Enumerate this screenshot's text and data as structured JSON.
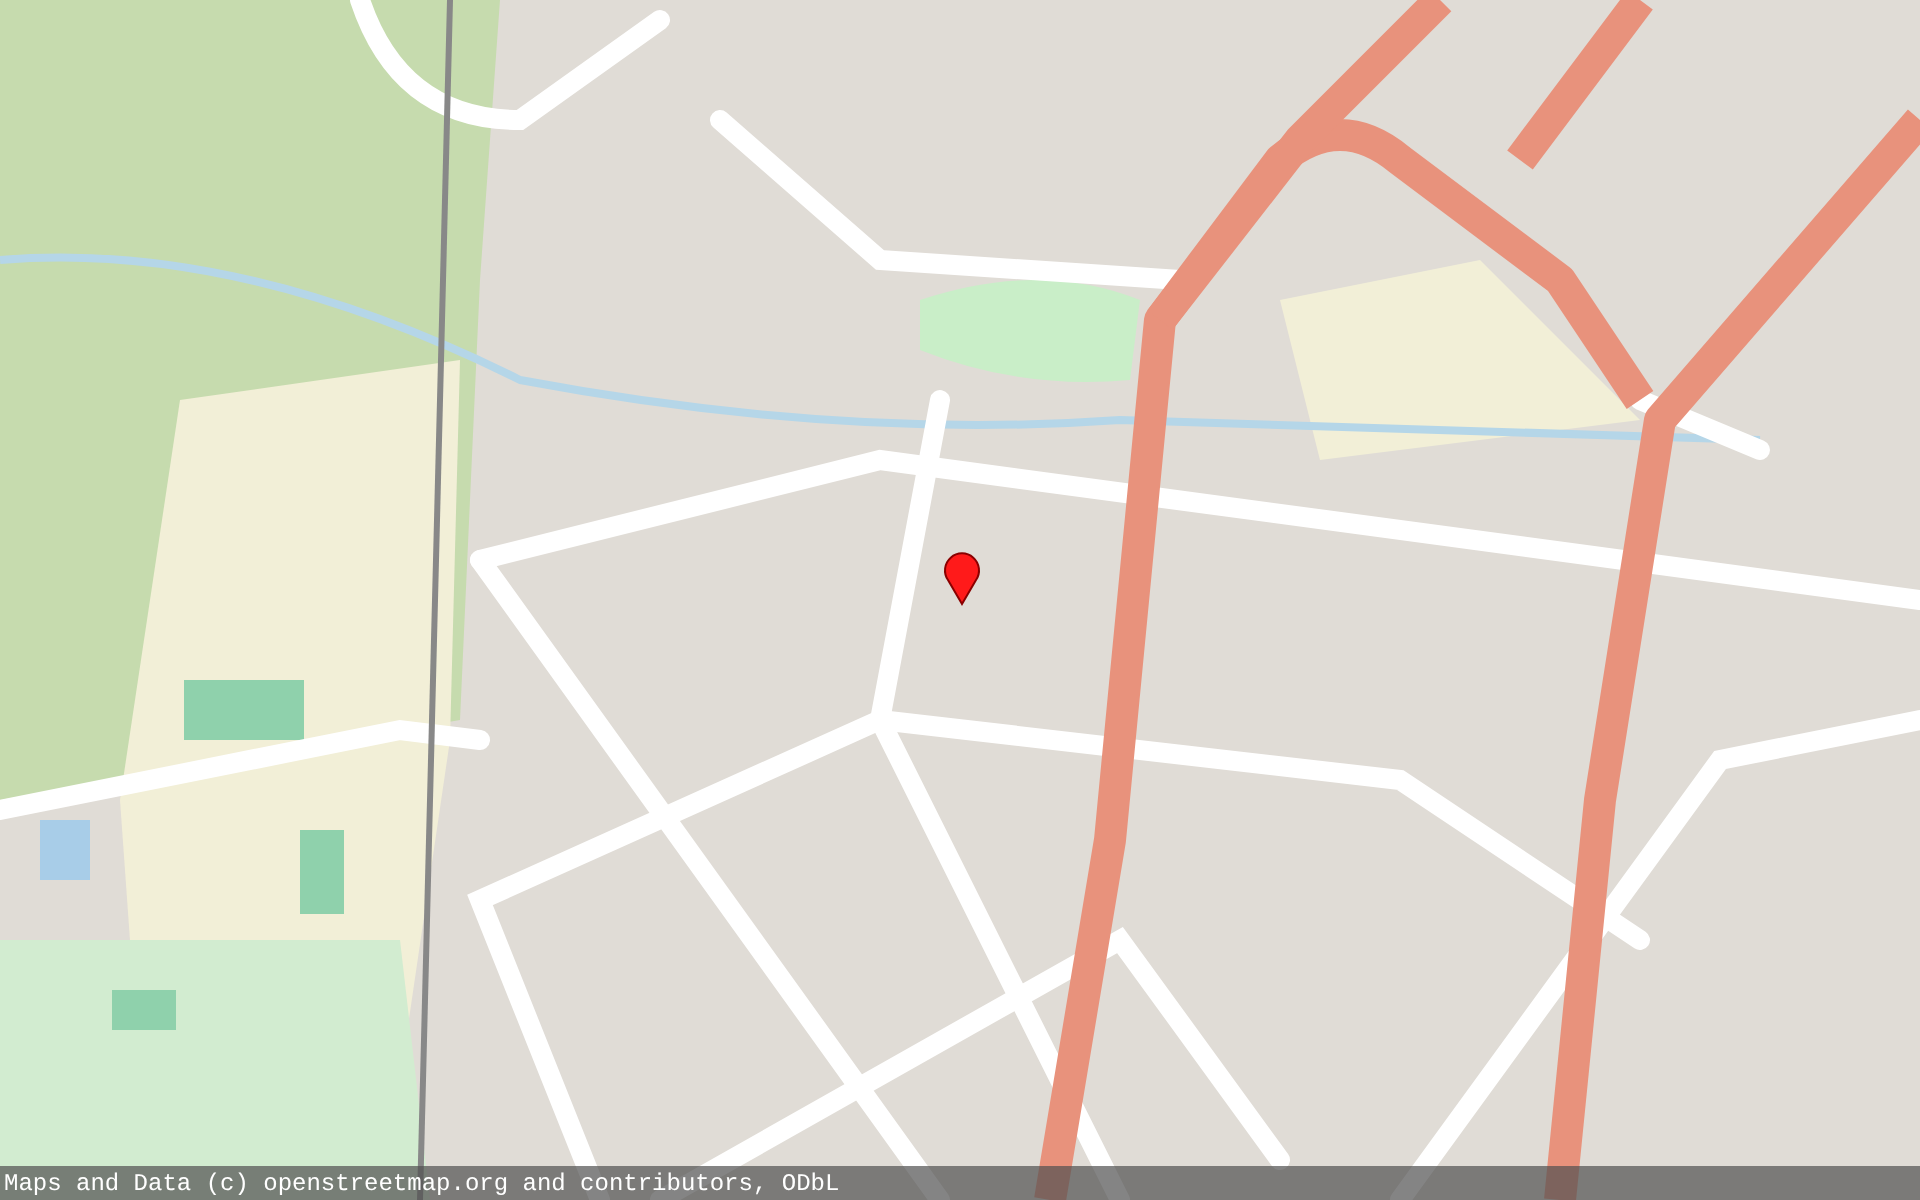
{
  "map": {
    "attribution": "Maps and Data (c) openstreetmap.org and contributors, ODbL",
    "marker": {
      "kind": "pin"
    }
  }
}
